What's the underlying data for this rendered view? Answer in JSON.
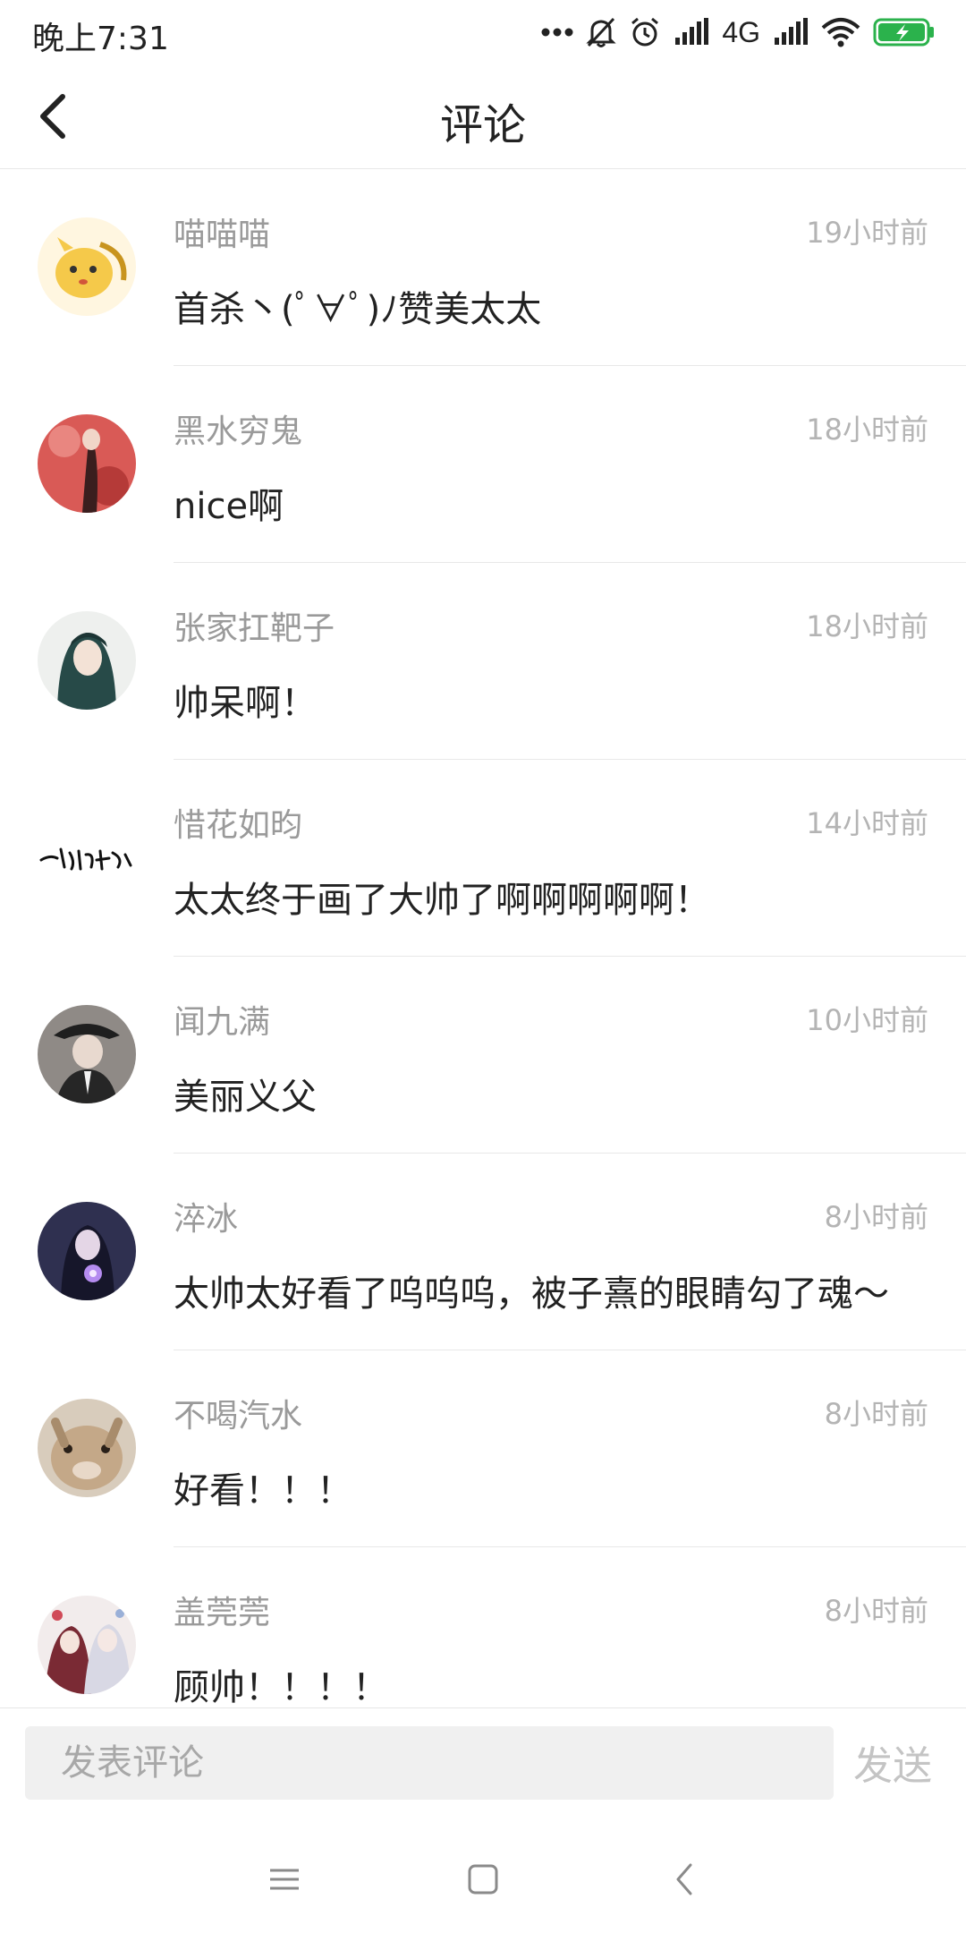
{
  "status_bar": {
    "time": "晚上7:31",
    "network": "4G",
    "battery_color": "#2bb24c",
    "icons": [
      "more-dots-icon",
      "mute-icon",
      "alarm-icon",
      "signal-icon",
      "signal-icon-2",
      "wifi-icon",
      "battery-charging-icon"
    ]
  },
  "header": {
    "title": "评论",
    "back_icon": "chevron-left-icon"
  },
  "comments": [
    {
      "user": "喵喵喵",
      "time": "19小时前",
      "text": "首杀丶(ﾟ∀ﾟ)ﾉ赞美太太"
    },
    {
      "user": "黑水穷鬼",
      "time": "18小时前",
      "text": "nice啊"
    },
    {
      "user": "张家扛靶子",
      "time": "18小时前",
      "text": "帅呆啊！"
    },
    {
      "user": "惜花如昀",
      "time": "14小时前",
      "text": "太太终于画了大帅了啊啊啊啊啊！"
    },
    {
      "user": "闻九满",
      "time": "10小时前",
      "text": "美丽义父"
    },
    {
      "user": "淬冰",
      "time": "8小时前",
      "text": "太帅太好看了呜呜呜，被子熹的眼睛勾了魂～"
    },
    {
      "user": "不喝汽水",
      "time": "8小时前",
      "text": "好看！！！"
    },
    {
      "user": "盖莞莞",
      "time": "8小时前",
      "text": "顾帅！！！！"
    }
  ],
  "input": {
    "placeholder": "发表评论",
    "value": "",
    "send_label": "发送"
  },
  "nav_bar": {
    "icons": [
      "menu-icon",
      "home-icon",
      "back-icon"
    ]
  },
  "colors": {
    "divider": "#e8e8e8",
    "username": "#9a9a9a",
    "timestamp": "#b4b4b4",
    "input_bg": "#f0f0f0",
    "send_disabled": "#c4c4c4"
  }
}
